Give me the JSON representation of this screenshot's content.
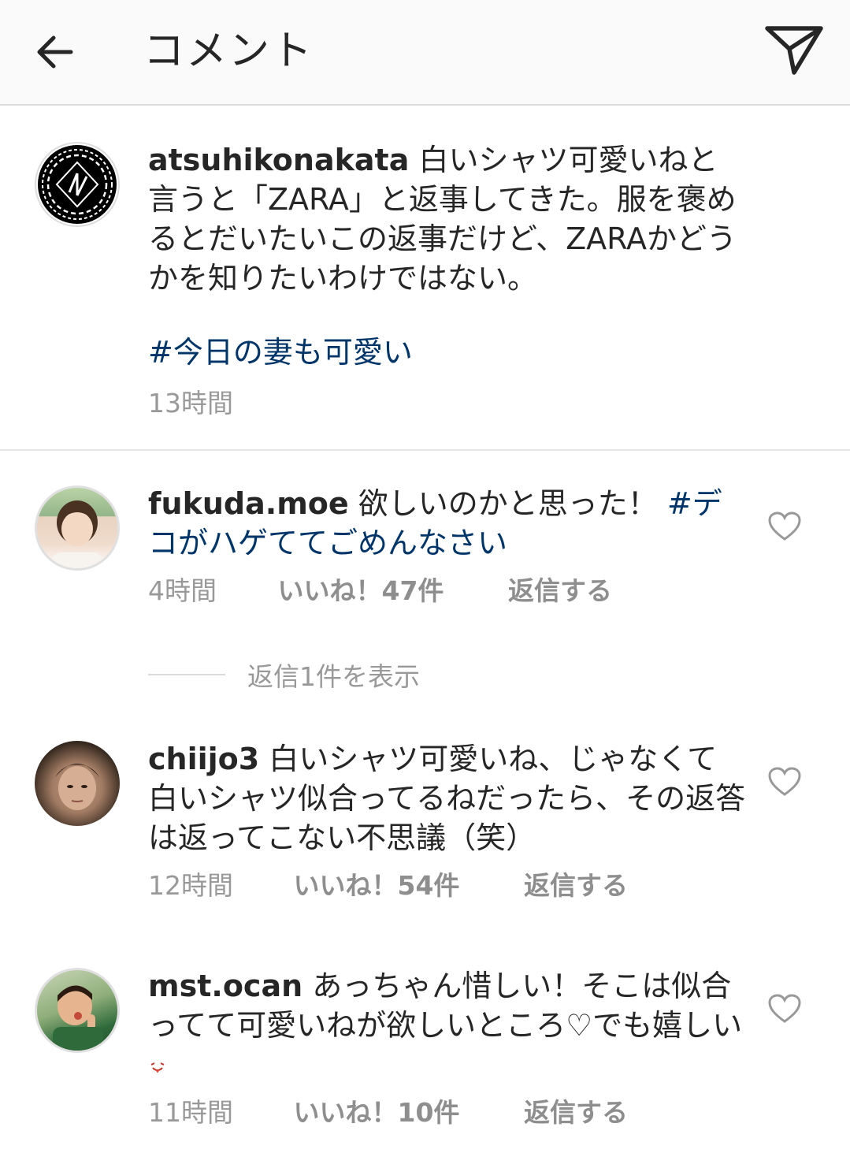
{
  "header": {
    "title": "コメント"
  },
  "caption": {
    "username": "atsuhikonakata",
    "text": "白いシャツ可愛いねと言うと「ZARA」と返事してきた。服を褒めるとだいたいこの返事だけど、ZARAかどうかを知りたいわけではない。",
    "hashtag": "#今日の妻も可愛い",
    "time": "13時間"
  },
  "comments": [
    {
      "username": "fukuda.moe",
      "text": "欲しいのかと思った！",
      "hashtag": "#デコがハゲててごめんなさい",
      "time": "4時間",
      "likes": "いいね！47件",
      "reply": "返信する",
      "view_replies": "返信1件を表示"
    },
    {
      "username": "chiijo3",
      "text": "白いシャツ可愛いね、じゃなくて白いシャツ似合ってるねだったら、その返答は返ってこない不思議（笑）",
      "time": "12時間",
      "likes": "いいね！54件",
      "reply": "返信する"
    },
    {
      "username": "mst.ocan",
      "text": "あっちゃん惜しい！そこは似合ってて可愛いねが欲しいところ♡でも嬉しい",
      "time": "11時間",
      "likes": "いいね！10件",
      "reply": "返信する"
    }
  ],
  "icons": {
    "back": "arrow-left-icon",
    "send": "paper-plane-icon",
    "like": "heart-outline-icon",
    "emoji": "tongue-face-emoji"
  },
  "colors": {
    "hashtag": "#003569",
    "meta": "#999999",
    "header_bg": "#fafafa"
  }
}
